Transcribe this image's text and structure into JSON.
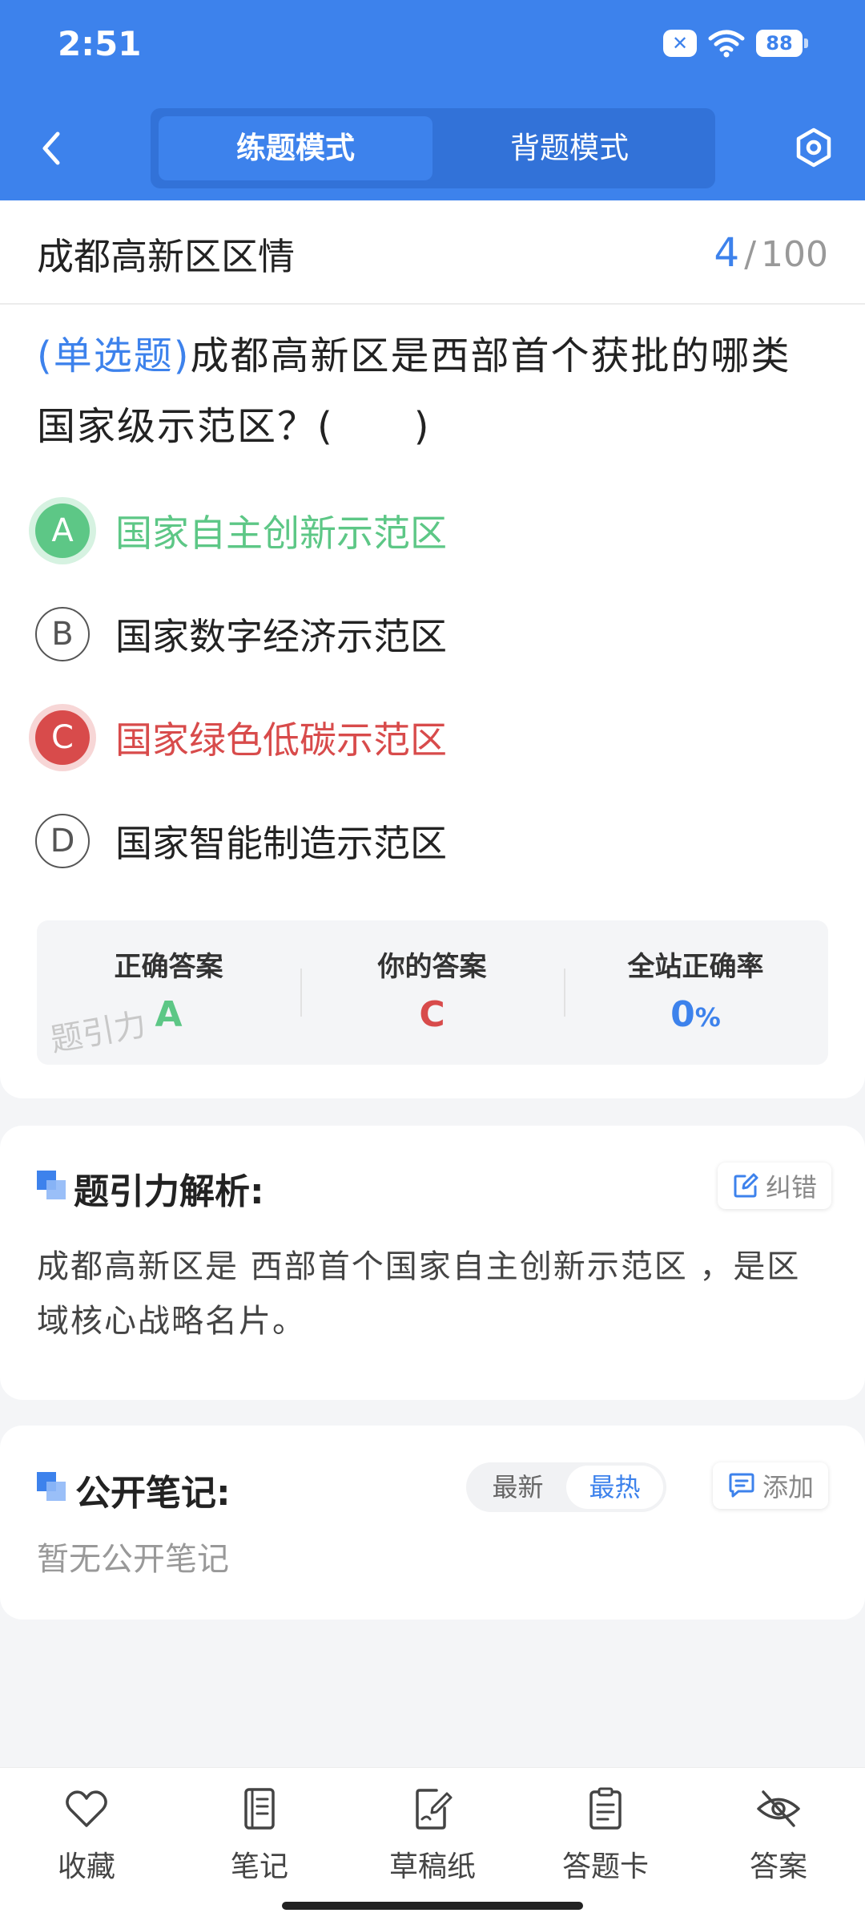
{
  "status_bar": {
    "time": "2:51",
    "battery": "88"
  },
  "header": {
    "modes": [
      {
        "label": "练题模式",
        "active": true
      },
      {
        "label": "背题模式",
        "active": false
      }
    ]
  },
  "topic": {
    "title": "成都高新区区情",
    "current": "4",
    "separator": "/",
    "total": "100"
  },
  "question": {
    "type": "(单选题)",
    "text": "成都高新区是西部首个获批的哪类国家级示范区？(　　)"
  },
  "options": [
    {
      "key": "A",
      "text": "国家自主创新示范区",
      "state": "correct"
    },
    {
      "key": "B",
      "text": "国家数字经济示范区",
      "state": "normal"
    },
    {
      "key": "C",
      "text": "国家绿色低碳示范区",
      "state": "wrong"
    },
    {
      "key": "D",
      "text": "国家智能制造示范区",
      "state": "normal"
    }
  ],
  "answer_panel": {
    "correct_label": "正确答案",
    "correct_value": "A",
    "yours_label": "你的答案",
    "yours_value": "C",
    "rate_label": "全站正确率",
    "rate_value": "0",
    "rate_unit": "%",
    "watermark": "题引力"
  },
  "analysis": {
    "title": "题引力解析:",
    "report_label": "纠错",
    "text": "成都高新区是 西部首个国家自主创新示范区 ，是区域核心战略名片。"
  },
  "notes": {
    "title": "公开笔记:",
    "sort_newest": "最新",
    "sort_hottest": "最热",
    "add_label": "添加",
    "empty_text": "暂无公开笔记"
  },
  "bottom_nav": [
    {
      "label": "收藏",
      "icon": "heart-icon"
    },
    {
      "label": "笔记",
      "icon": "notebook-icon"
    },
    {
      "label": "草稿纸",
      "icon": "draft-paper-icon"
    },
    {
      "label": "答题卡",
      "icon": "answer-card-icon"
    },
    {
      "label": "答案",
      "icon": "eye-off-icon"
    }
  ],
  "colors": {
    "primary": "#3d82ec",
    "correct": "#5dc786",
    "wrong": "#d84b4b"
  }
}
